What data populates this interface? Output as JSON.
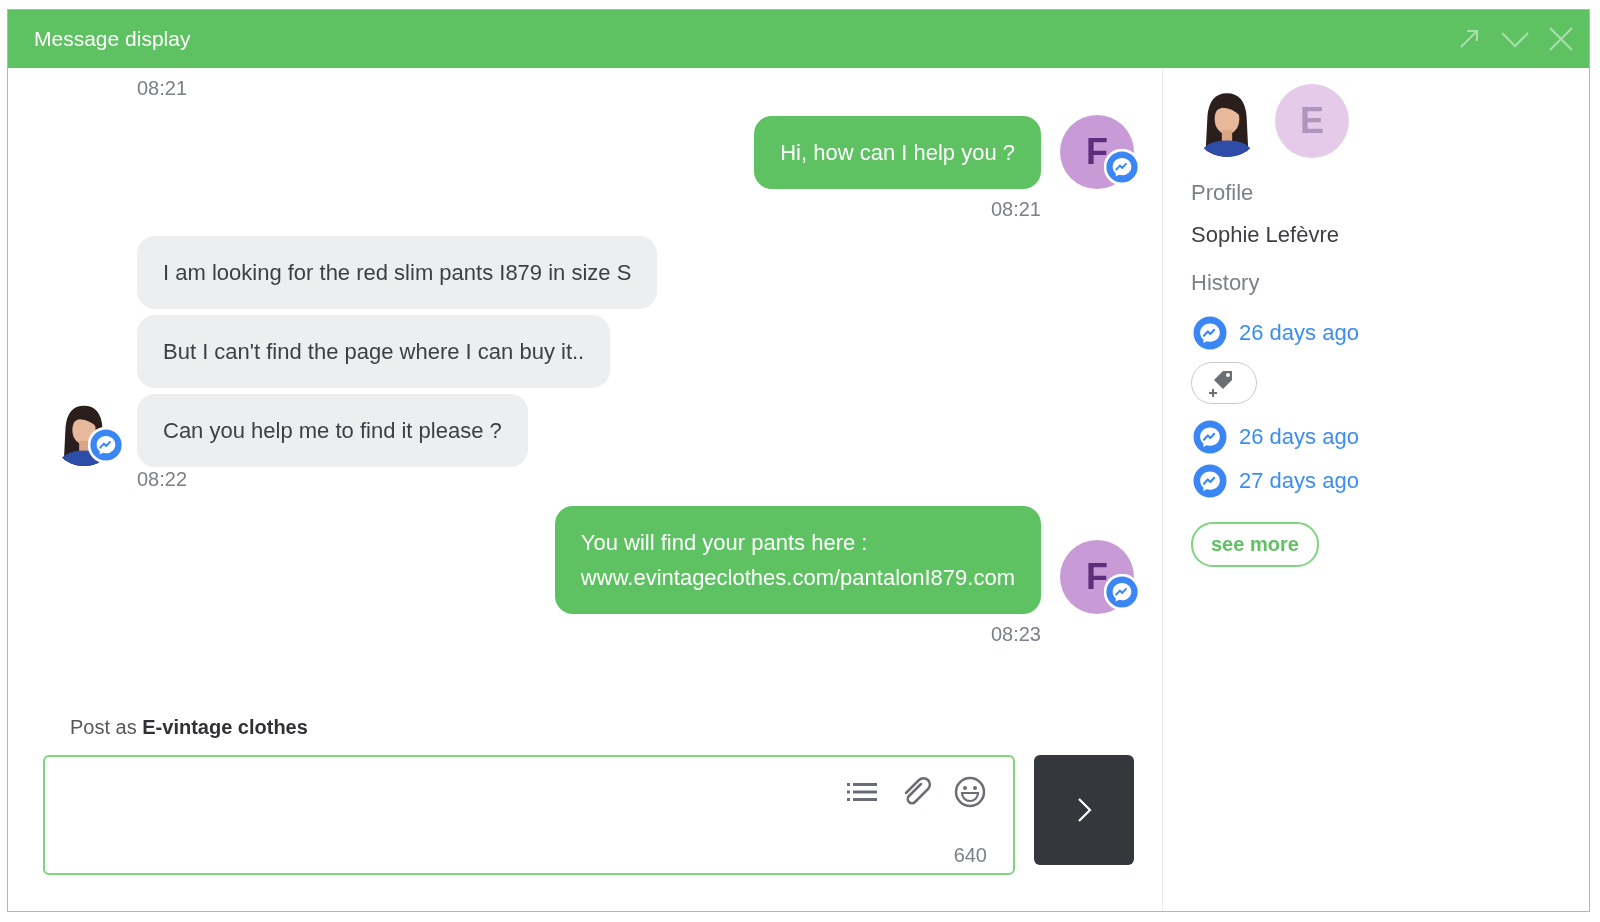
{
  "window": {
    "title": "Message display"
  },
  "cut_off_message": {
    "time": "08:21"
  },
  "conversation": [
    {
      "kind": "outgoing",
      "avatar_letter": "F",
      "bubbles": [
        "Hi, how can I help you ?"
      ],
      "time": "08:21"
    },
    {
      "kind": "incoming",
      "bubbles": [
        "I am looking for the red slim pants I879 in size S",
        "But I can't find the page where I can buy it..",
        "Can you help me to find it please ?"
      ],
      "time": "08:22"
    },
    {
      "kind": "outgoing",
      "avatar_letter": "F",
      "bubbles": [
        "You will find your pants here :\nwww.evintageclothes.com/pantalonI879.com"
      ],
      "time": "08:23"
    }
  ],
  "composer": {
    "post_as": "Post as **E-vintage clothes**",
    "char_count": "640"
  },
  "sidebar": {
    "page_avatar_letter": "E",
    "profile_label": "Profile",
    "name": "Sophie Lefèvre",
    "history_label": "History",
    "history": [
      {
        "kind": "messenger",
        "text": "26 days ago"
      },
      {
        "kind": "tag_button"
      },
      {
        "kind": "messenger",
        "text": "26 days ago"
      },
      {
        "kind": "messenger",
        "text": "27 days ago"
      }
    ],
    "see_more": "see more"
  }
}
